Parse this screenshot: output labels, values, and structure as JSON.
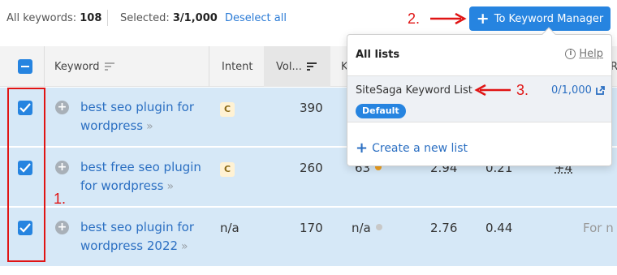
{
  "topbar": {
    "all_keywords_label": "All keywords:",
    "all_keywords_count": "108",
    "selected_label": "Selected:",
    "selected_count": "3/1,000",
    "deselect_label": "Deselect all",
    "to_km_label": "To Keyword Manager"
  },
  "annotations": {
    "step1": "1.",
    "step2": "2.",
    "step3": "3."
  },
  "columns": {
    "keyword": "Keyword",
    "intent": "Intent",
    "volume": "Vol...",
    "kd_partial": "K",
    "extra_partial": "R"
  },
  "rows": [
    {
      "keyword_line1": "best seo plugin for",
      "keyword_line2": "wordpress",
      "intent": "C",
      "volume": "390"
    },
    {
      "keyword_line1": "best free seo plugin",
      "keyword_line2": "for wordpress",
      "intent": "C",
      "volume": "260",
      "kd_partial": "63",
      "cpc_partial": "2.94",
      "com_partial": "0.21",
      "serp_partial": "+4"
    },
    {
      "keyword_line1": "best seo plugin for",
      "keyword_line2": "wordpress 2022",
      "intent": "n/a",
      "volume": "170",
      "kd": "n/a",
      "cpc": "2.76",
      "com": "0.44",
      "serp": "For n"
    }
  ],
  "popup": {
    "title": "All lists",
    "help": "Help",
    "list_name": "SiteSaga Keyword List",
    "list_count": "0/1,000",
    "default_badge": "Default",
    "create_label": "Create a new list"
  },
  "colors": {
    "accent": "#2684e0",
    "link": "#2b6fc2",
    "row_selected": "#d6e8f7",
    "annotation": "#e01414",
    "kd_orange": "#f0a020",
    "kd_gray": "#c8c8c8"
  }
}
